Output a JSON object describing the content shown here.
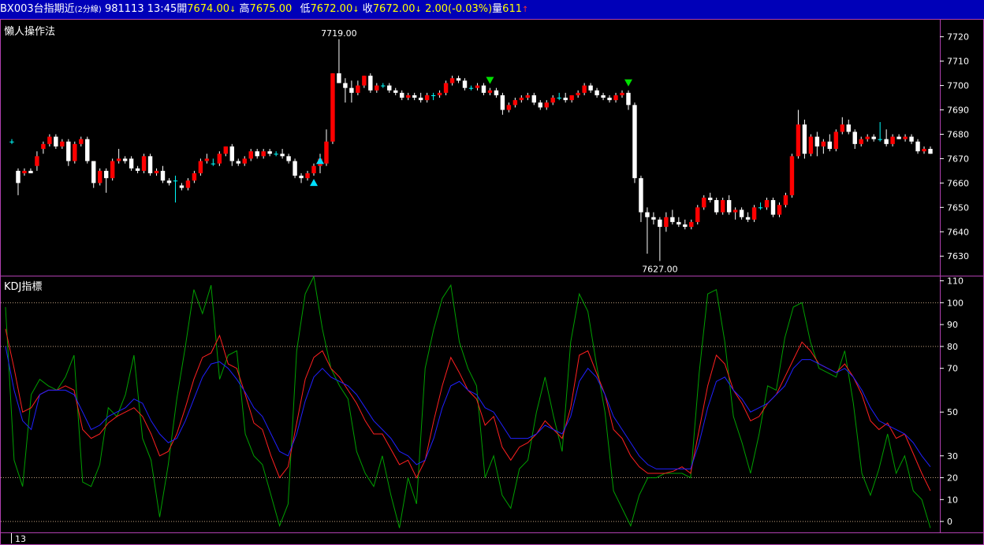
{
  "header": {
    "symbol": "BX003",
    "name": "台指期近",
    "period": "(2分線)",
    "date": "981113",
    "time": "13:45",
    "open_label": "開",
    "open_value": "7674.00",
    "open_arrow": "↓",
    "high_label": "高",
    "high_value": "7675.00",
    "low_label": "低",
    "low_value": "7672.00",
    "low_arrow": "↓",
    "close_label": "收",
    "close_value": "7672.00",
    "close_arrow": "↓",
    "change": "2.00(-0.03%)",
    "volume_label": "量",
    "volume_value": "611",
    "volume_arrow": "↑"
  },
  "colors": {
    "background": "#000000",
    "title_bar": "#0000b8",
    "border": "#b040b0",
    "up": "#ff0000",
    "down": "#ffffff",
    "doji": "#00ffff",
    "k_line": "#ff2020",
    "d_line": "#2020ff",
    "j_line": "#00a000",
    "buy_marker": "#00e0ff",
    "sell_marker": "#00e000"
  },
  "price_pane": {
    "title": "懶人操作法",
    "y_ticks": [
      "7720",
      "7710",
      "7700",
      "7690",
      "7680",
      "7670",
      "7660",
      "7650",
      "7640",
      "7630"
    ],
    "high_annotation": "7719.00",
    "low_annotation": "7627.00"
  },
  "kdj_pane": {
    "title": "KDJ指標",
    "y_ticks": [
      "110",
      "100",
      "90",
      "80",
      "70",
      "50",
      "30",
      "20",
      "10",
      "0"
    ]
  },
  "footer": {
    "x_label": "13"
  },
  "chart_data": [
    {
      "type": "candlestick",
      "title": "懶人操作法",
      "ylim": [
        7622,
        7727
      ],
      "high": 7719.0,
      "low": 7627.0,
      "candles": [
        [
          7677,
          7678,
          7676,
          7677
        ],
        [
          7665,
          7666,
          7655,
          7660
        ],
        [
          7664,
          7666,
          7663,
          7665
        ],
        [
          7665,
          7666,
          7664,
          7664
        ],
        [
          7667,
          7673,
          7665,
          7671
        ],
        [
          7674,
          7677,
          7672,
          7676
        ],
        [
          7676,
          7680,
          7675,
          7679
        ],
        [
          7679,
          7680,
          7674,
          7675
        ],
        [
          7675,
          7678,
          7674,
          7677
        ],
        [
          7677,
          7678,
          7667,
          7669
        ],
        [
          7669,
          7677,
          7668,
          7676
        ],
        [
          7676,
          7679,
          7675,
          7678
        ],
        [
          7678,
          7679,
          7668,
          7669
        ],
        [
          7669,
          7669,
          7658,
          7660
        ],
        [
          7660,
          7666,
          7659,
          7665
        ],
        [
          7665,
          7666,
          7656,
          7662
        ],
        [
          7662,
          7670,
          7661,
          7669
        ],
        [
          7669,
          7674,
          7668,
          7670
        ],
        [
          7670,
          7671,
          7668,
          7669
        ],
        [
          7670,
          7671,
          7665,
          7666
        ],
        [
          7666,
          7667,
          7664,
          7665
        ],
        [
          7665,
          7672,
          7664,
          7671
        ],
        [
          7671,
          7672,
          7663,
          7664
        ],
        [
          7664,
          7666,
          7663,
          7665
        ],
        [
          7665,
          7667,
          7660,
          7661
        ],
        [
          7661,
          7662,
          7659,
          7660
        ],
        [
          7661,
          7663,
          7652,
          7661
        ],
        [
          7659,
          7660,
          7657,
          7658
        ],
        [
          7658,
          7662,
          7657,
          7661
        ],
        [
          7661,
          7665,
          7660,
          7664
        ],
        [
          7664,
          7670,
          7663,
          7669
        ],
        [
          7669,
          7672,
          7668,
          7670
        ],
        [
          7668,
          7670,
          7667,
          7668
        ],
        [
          7668,
          7673,
          7667,
          7672
        ],
        [
          7672,
          7675,
          7671,
          7675
        ],
        [
          7675,
          7676,
          7667,
          7669
        ],
        [
          7669,
          7670,
          7667,
          7668
        ],
        [
          7668,
          7671,
          7667,
          7670
        ],
        [
          7670,
          7674,
          7669,
          7673
        ],
        [
          7673,
          7674,
          7670,
          7671
        ],
        [
          7671,
          7674,
          7670,
          7673
        ],
        [
          7673,
          7674,
          7671,
          7672
        ],
        [
          7672,
          7673,
          7671,
          7672
        ],
        [
          7672,
          7674,
          7670,
          7671
        ],
        [
          7671,
          7672,
          7668,
          7669
        ],
        [
          7669,
          7670,
          7662,
          7663
        ],
        [
          7663,
          7664,
          7660,
          7662
        ],
        [
          7662,
          7665,
          7661,
          7664
        ],
        [
          7664,
          7668,
          7663,
          7667
        ],
        [
          7667,
          7672,
          7664,
          7670
        ],
        [
          7668,
          7682,
          7667,
          7677
        ],
        [
          7677,
          7705,
          7676,
          7705
        ],
        [
          7705,
          7719,
          7702,
          7701
        ],
        [
          7701,
          7703,
          7693,
          7699
        ],
        [
          7699,
          7702,
          7693,
          7697
        ],
        [
          7697,
          7702,
          7696,
          7700
        ],
        [
          7700,
          7704,
          7699,
          7704
        ],
        [
          7704,
          7705,
          7697,
          7698
        ],
        [
          7698,
          7701,
          7697,
          7700
        ],
        [
          7700,
          7701,
          7699,
          7700
        ],
        [
          7700,
          7701,
          7697,
          7698
        ],
        [
          7698,
          7699,
          7696,
          7697
        ],
        [
          7697,
          7698,
          7694,
          7695
        ],
        [
          7695,
          7697,
          7694,
          7696
        ],
        [
          7696,
          7697,
          7694,
          7695
        ],
        [
          7695,
          7697,
          7693,
          7694
        ],
        [
          7694,
          7697,
          7693,
          7696
        ],
        [
          7696,
          7697,
          7694,
          7696
        ],
        [
          7696,
          7698,
          7695,
          7697
        ],
        [
          7697,
          7702,
          7696,
          7701
        ],
        [
          7701,
          7704,
          7700,
          7703
        ],
        [
          7703,
          7704,
          7701,
          7702
        ],
        [
          7702,
          7703,
          7698,
          7699
        ],
        [
          7699,
          7700,
          7698,
          7699
        ],
        [
          7699,
          7701,
          7698,
          7700
        ],
        [
          7700,
          7701,
          7696,
          7697
        ],
        [
          7697,
          7699,
          7696,
          7698
        ],
        [
          7698,
          7699,
          7695,
          7696
        ],
        [
          7696,
          7697,
          7688,
          7690
        ],
        [
          7690,
          7693,
          7689,
          7692
        ],
        [
          7692,
          7695,
          7691,
          7694
        ],
        [
          7694,
          7696,
          7693,
          7695
        ],
        [
          7695,
          7697,
          7694,
          7696
        ],
        [
          7696,
          7697,
          7692,
          7693
        ],
        [
          7693,
          7694,
          7690,
          7691
        ],
        [
          7691,
          7694,
          7690,
          7693
        ],
        [
          7693,
          7696,
          7692,
          7695
        ],
        [
          7695,
          7697,
          7694,
          7695
        ],
        [
          7695,
          7697,
          7693,
          7694
        ],
        [
          7694,
          7696,
          7693,
          7696
        ],
        [
          7696,
          7698,
          7695,
          7697
        ],
        [
          7697,
          7701,
          7696,
          7700
        ],
        [
          7700,
          7701,
          7697,
          7698
        ],
        [
          7698,
          7699,
          7695,
          7696
        ],
        [
          7696,
          7697,
          7694,
          7695
        ],
        [
          7695,
          7696,
          7693,
          7694
        ],
        [
          7694,
          7697,
          7693,
          7696
        ],
        [
          7696,
          7698,
          7695,
          7697
        ],
        [
          7697,
          7698,
          7690,
          7692
        ],
        [
          7692,
          7693,
          7660,
          7662
        ],
        [
          7662,
          7663,
          7644,
          7648
        ],
        [
          7648,
          7650,
          7631,
          7646
        ],
        [
          7646,
          7648,
          7643,
          7645
        ],
        [
          7645,
          7646,
          7628,
          7642
        ],
        [
          7642,
          7648,
          7640,
          7646
        ],
        [
          7646,
          7649,
          7643,
          7644
        ],
        [
          7644,
          7646,
          7642,
          7643
        ],
        [
          7643,
          7645,
          7641,
          7642
        ],
        [
          7642,
          7645,
          7641,
          7644
        ],
        [
          7644,
          7651,
          7643,
          7650
        ],
        [
          7650,
          7655,
          7649,
          7654
        ],
        [
          7654,
          7656,
          7652,
          7653
        ],
        [
          7653,
          7654,
          7647,
          7648
        ],
        [
          7648,
          7654,
          7647,
          7653
        ],
        [
          7653,
          7655,
          7647,
          7648
        ],
        [
          7648,
          7650,
          7645,
          7649
        ],
        [
          7649,
          7650,
          7645,
          7646
        ],
        [
          7646,
          7648,
          7644,
          7645
        ],
        [
          7645,
          7651,
          7644,
          7650
        ],
        [
          7650,
          7652,
          7649,
          7650
        ],
        [
          7650,
          7654,
          7649,
          7653
        ],
        [
          7653,
          7654,
          7646,
          7647
        ],
        [
          7647,
          7652,
          7646,
          7651
        ],
        [
          7651,
          7656,
          7650,
          7655
        ],
        [
          7655,
          7672,
          7654,
          7671
        ],
        [
          7671,
          7690,
          7670,
          7684
        ],
        [
          7684,
          7686,
          7670,
          7672
        ],
        [
          7672,
          7680,
          7671,
          7679
        ],
        [
          7679,
          7681,
          7671,
          7675
        ],
        [
          7675,
          7678,
          7672,
          7677
        ],
        [
          7677,
          7680,
          7673,
          7674
        ],
        [
          7674,
          7682,
          7673,
          7681
        ],
        [
          7681,
          7687,
          7680,
          7684
        ],
        [
          7684,
          7686,
          7680,
          7681
        ],
        [
          7681,
          7682,
          7674,
          7676
        ],
        [
          7676,
          7679,
          7675,
          7678
        ],
        [
          7678,
          7680,
          7677,
          7679
        ],
        [
          7679,
          7680,
          7677,
          7678
        ],
        [
          7678,
          7685,
          7677,
          7678
        ],
        [
          7678,
          7682,
          7675,
          7676
        ],
        [
          7676,
          7680,
          7675,
          7679
        ],
        [
          7679,
          7680,
          7678,
          7678
        ],
        [
          7678,
          7680,
          7677,
          7679
        ],
        [
          7679,
          7680,
          7676,
          7677
        ],
        [
          7677,
          7678,
          7672,
          7673
        ],
        [
          7673,
          7675,
          7672,
          7674
        ],
        [
          7674,
          7675,
          7672,
          7672
        ]
      ]
    },
    {
      "type": "line",
      "title": "KDJ指標",
      "ylim": [
        -5,
        112
      ],
      "series": [
        {
          "name": "K",
          "values": [
            88,
            70,
            50,
            52,
            58,
            60,
            60,
            62,
            60,
            42,
            38,
            40,
            45,
            48,
            50,
            52,
            48,
            40,
            30,
            32,
            40,
            52,
            65,
            75,
            77,
            85,
            72,
            70,
            58,
            45,
            42,
            30,
            20,
            25,
            45,
            65,
            75,
            78,
            70,
            66,
            60,
            54,
            46,
            40,
            40,
            33,
            26,
            28,
            20,
            28,
            46,
            62,
            75,
            68,
            60,
            56,
            44,
            48,
            34,
            28,
            34,
            36,
            40,
            46,
            42,
            38,
            52,
            76,
            78,
            68,
            58,
            42,
            38,
            30,
            25,
            22,
            22,
            22,
            23,
            25,
            22,
            42,
            62,
            76,
            72,
            60,
            54,
            46,
            48,
            54,
            58,
            66,
            74,
            82,
            78,
            72,
            70,
            68,
            72,
            66,
            58,
            46,
            42,
            45,
            38,
            40,
            31,
            22,
            14
          ]
        },
        {
          "name": "D",
          "values": [
            80,
            60,
            46,
            42,
            58,
            60,
            60,
            60,
            58,
            50,
            42,
            44,
            48,
            50,
            52,
            56,
            54,
            46,
            40,
            36,
            38,
            46,
            56,
            66,
            72,
            73,
            70,
            65,
            59,
            52,
            48,
            40,
            32,
            30,
            40,
            55,
            66,
            70,
            66,
            64,
            62,
            58,
            52,
            46,
            42,
            38,
            32,
            30,
            26,
            28,
            38,
            52,
            62,
            64,
            60,
            58,
            52,
            50,
            44,
            38,
            38,
            38,
            40,
            44,
            42,
            40,
            48,
            64,
            70,
            66,
            58,
            48,
            42,
            36,
            30,
            26,
            24,
            24,
            24,
            24,
            24,
            36,
            52,
            64,
            66,
            60,
            56,
            50,
            52,
            54,
            58,
            62,
            70,
            74,
            74,
            72,
            70,
            68,
            70,
            66,
            60,
            52,
            46,
            44,
            42,
            40,
            36,
            30,
            25
          ]
        },
        {
          "name": "J",
          "values": [
            98,
            28,
            16,
            58,
            65,
            62,
            60,
            66,
            76,
            18,
            16,
            26,
            52,
            48,
            58,
            76,
            38,
            28,
            2,
            26,
            56,
            80,
            106,
            95,
            108,
            65,
            76,
            78,
            40,
            30,
            26,
            12,
            -2,
            8,
            78,
            104,
            112,
            88,
            70,
            62,
            56,
            32,
            22,
            16,
            30,
            12,
            -3,
            20,
            8,
            70,
            88,
            102,
            108,
            82,
            70,
            62,
            20,
            30,
            12,
            6,
            24,
            28,
            50,
            66,
            48,
            32,
            82,
            104,
            96,
            72,
            50,
            14,
            6,
            -2,
            12,
            20,
            20,
            22,
            22,
            22,
            20,
            68,
            104,
            106,
            82,
            48,
            36,
            22,
            40,
            62,
            60,
            84,
            98,
            100,
            82,
            70,
            68,
            66,
            78,
            54,
            22,
            12,
            24,
            40,
            22,
            30,
            14,
            10,
            -3
          ]
        }
      ]
    }
  ]
}
